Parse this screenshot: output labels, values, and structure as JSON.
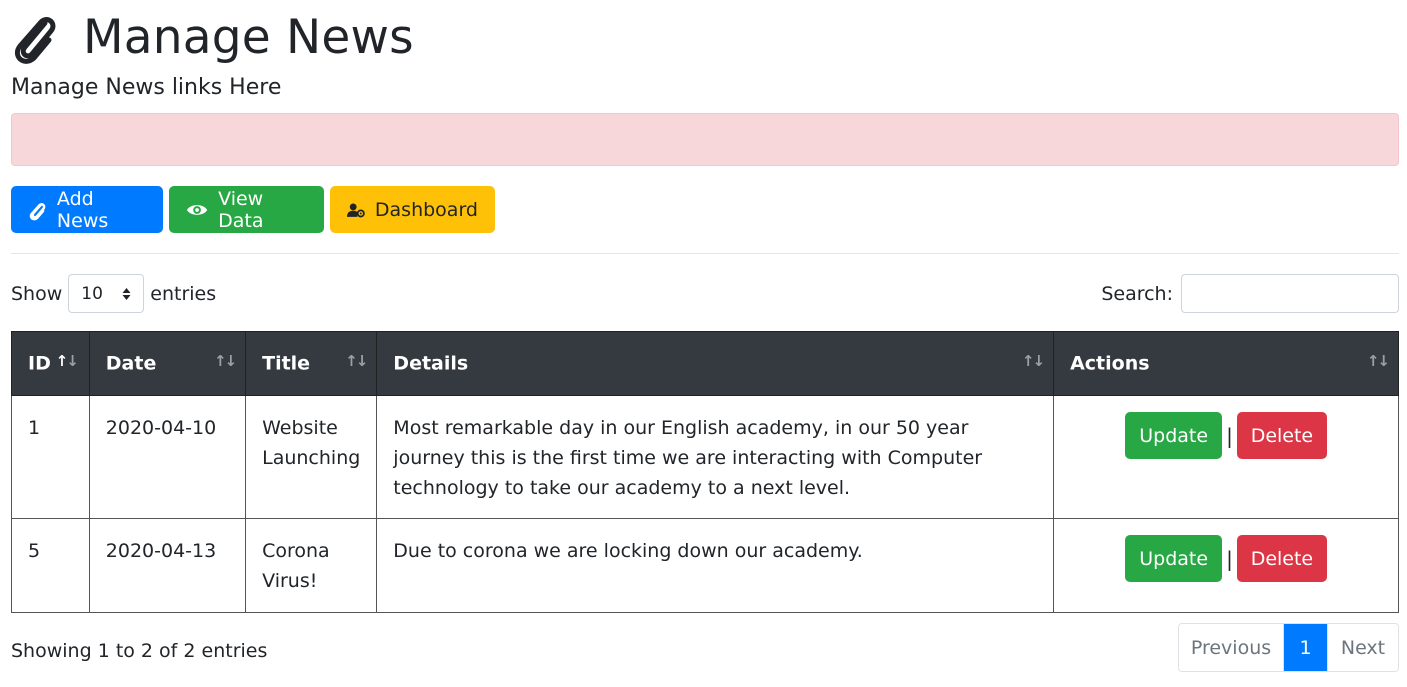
{
  "header": {
    "title": "Manage News",
    "subtitle": "Manage News links Here",
    "icon": "paperclip-icon"
  },
  "toolbar": {
    "add_label": "Add News",
    "view_label": "View Data",
    "dashboard_label": "Dashboard",
    "colors": {
      "primary": "#007bff",
      "success": "#28a745",
      "warning": "#ffc107"
    }
  },
  "alert": {
    "color": "#f8d7da"
  },
  "table_controls": {
    "show_label": "Show",
    "entries_value": "10",
    "entries_label": "entries",
    "search_label": "Search:",
    "search_value": ""
  },
  "table": {
    "columns": [
      "ID",
      "Date",
      "Title",
      "Details",
      "Actions"
    ],
    "sorted_column": "ID",
    "rows": [
      {
        "id": "1",
        "date": "2020-04-10",
        "title": "Website Launching",
        "details": "Most remarkable day in our English academy, in our 50 year journey this is the first time we are interacting with Computer technology to take our academy to a next level.",
        "update_label": "Update",
        "separator": "|",
        "delete_label": "Delete"
      },
      {
        "id": "5",
        "date": "2020-04-13",
        "title": "Corona Virus!",
        "details": "Due to corona we are locking down our academy.",
        "update_label": "Update",
        "separator": "|",
        "delete_label": "Delete"
      }
    ]
  },
  "footer": {
    "info": "Showing 1 to 2 of 2 entries",
    "previous_label": "Previous",
    "current_page": "1",
    "next_label": "Next"
  }
}
